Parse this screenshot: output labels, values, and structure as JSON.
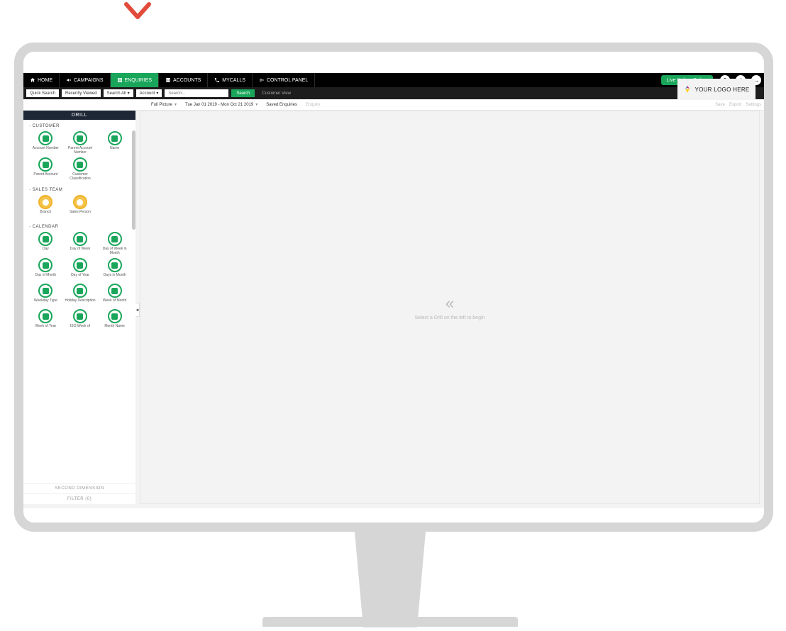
{
  "nav": {
    "home": "HOME",
    "campaigns": "CAMPAIGNS",
    "enquiries": "ENQUIRIES",
    "accounts": "ACCOUNTS",
    "mycalls": "MYCALLS",
    "control_panel": "CONTROL PANEL",
    "live_help": "Live Help",
    "live_help_status": "Online"
  },
  "search": {
    "quick": "Quick Search",
    "recently": "Recently Viewed",
    "search_all": "Search All",
    "account": "Account",
    "placeholder": "Search...",
    "btn": "Search",
    "customer_view": "Customer View"
  },
  "logo_text": "YOUR LOGO HERE",
  "crumbs": {
    "full_picture": "Full Picture",
    "date_range": "Tue Jan 01 2019 - Mon Oct 21 2019",
    "saved": "Saved Enquiries",
    "enquiry": "Enquiry",
    "right": {
      "save": "Save",
      "export": "Export",
      "settings": "Settings"
    }
  },
  "drill": {
    "header": "DRILL",
    "sections": [
      {
        "title": "CUSTOMER",
        "color": "green",
        "items": [
          "Account Number",
          "Parent Account Number",
          "Name",
          "Parent Account",
          "Customer Classification"
        ]
      },
      {
        "title": "SALES TEAM",
        "color": "yellow",
        "items": [
          "Branch",
          "Sales Person"
        ]
      },
      {
        "title": "CALENDAR",
        "color": "green",
        "items": [
          "Day",
          "Day of Week",
          "Day of Week in Month",
          "Day of Month",
          "Day of Year",
          "Days in Month",
          "Weekday Type",
          "Holiday Description",
          "Week of Month",
          "Week of Year",
          "ISO Week of",
          "Month Name"
        ]
      }
    ],
    "second_dim": "SECOND DIMENSION",
    "filter": "FILTER (0)"
  },
  "main": {
    "message": "Select a Drill on the left to begin"
  }
}
